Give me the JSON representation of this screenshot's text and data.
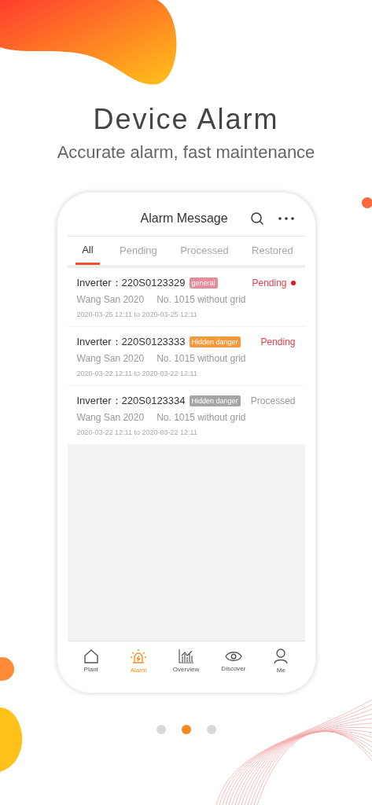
{
  "heading": "Device Alarm",
  "subheading": "Accurate alarm, fast maintenance",
  "screen": {
    "title": "Alarm Message",
    "tabs": [
      {
        "label": "All",
        "selected": true
      },
      {
        "label": "Pending",
        "selected": false
      },
      {
        "label": "Processed",
        "selected": false
      },
      {
        "label": "Restored",
        "selected": false
      }
    ],
    "alarms": [
      {
        "device": "Inverter：220S0123329",
        "tag": "general",
        "color": "#e58d9b",
        "status": "Pending",
        "kind": "pending",
        "unread": true,
        "plant": "Wang San 2020",
        "fault": "No. 1015 without grid",
        "period": "2020-03-25 12:11 to 2020-03-25 12:11"
      },
      {
        "device": "Inverter：220S0123333",
        "tag": "Hidden danger",
        "color": "#f59a3c",
        "status": "Pending",
        "kind": "pending",
        "unread": false,
        "plant": "Wang San 2020",
        "fault": "No. 1015 without grid",
        "period": "2020-03-22 12:11 to 2020-03-22 12:11"
      },
      {
        "device": "Inverter：220S0123334",
        "tag": "Hidden danger",
        "color": "#a6a6a6",
        "status": "Processed",
        "kind": "processed",
        "unread": false,
        "plant": "Wang San 2020",
        "fault": "No. 1015 without grid",
        "period": "2020-03-22 12:11 to 2020-03-22 12:11"
      }
    ],
    "nav": [
      {
        "label": "Plant",
        "selected": false
      },
      {
        "label": "Alarm",
        "selected": true
      },
      {
        "label": "Overview",
        "selected": false
      },
      {
        "label": "Discover",
        "selected": false
      },
      {
        "label": "Me",
        "selected": false
      }
    ]
  },
  "pager": [
    {
      "selected": false
    },
    {
      "selected": true
    },
    {
      "selected": false
    }
  ]
}
